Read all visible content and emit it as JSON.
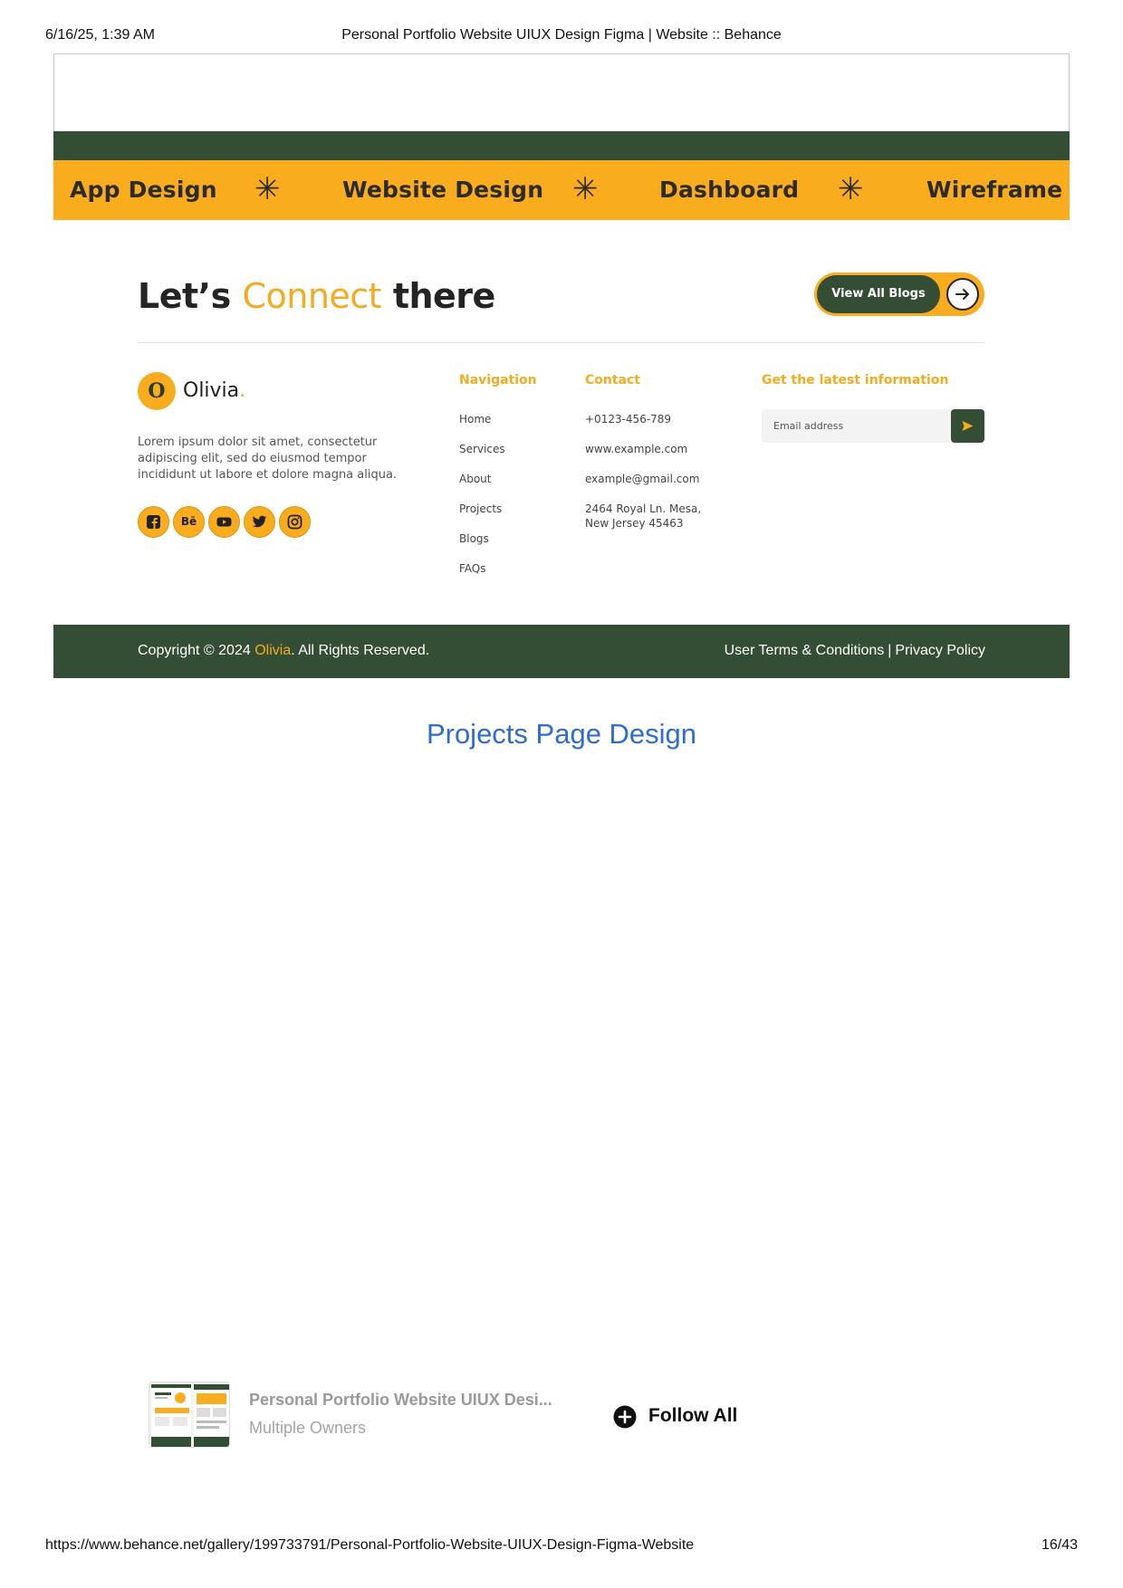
{
  "print_header": {
    "datetime": "6/16/25, 1:39 AM",
    "title": "Personal Portfolio Website UIUX Design Figma | Website :: Behance"
  },
  "print_footer": {
    "url": "https://www.behance.net/gallery/199733791/Personal-Portfolio-Website-UIUX-Design-Figma-Website",
    "page": "16/43"
  },
  "marquee": {
    "items": [
      "App Design",
      "Website Design",
      "Dashboard",
      "Wireframe"
    ],
    "separator": "✳"
  },
  "connect": {
    "heading_start": "Let’s",
    "heading_accent": "Connect",
    "heading_end": "there",
    "button_label": "View All Blogs",
    "button_icon": "arrow-right-icon"
  },
  "brand": {
    "badge_letter": "O",
    "name": "Olivia",
    "name_dot": ".",
    "description": "Lorem ipsum dolor sit amet, consectetur adipiscing elit, sed do eiusmod tempor incididunt ut labore et dolore magna aliqua.",
    "socials": [
      "facebook-icon",
      "behance-icon",
      "youtube-icon",
      "twitter-icon",
      "instagram-icon"
    ],
    "behance_label": "Bē"
  },
  "navigation": {
    "title": "Navigation",
    "links": [
      "Home",
      "Services",
      "About",
      "Projects",
      "Blogs",
      "FAQs"
    ]
  },
  "contact": {
    "title": "Contact",
    "phone": "+0123-456-789",
    "website": "www.example.com",
    "email": "example@gmail.com",
    "address_line1": "2464 Royal Ln. Mesa,",
    "address_line2": "New Jersey 45463"
  },
  "newsletter": {
    "title": "Get the latest information",
    "placeholder": "Email address",
    "send_icon": "send-icon"
  },
  "bottom_bar": {
    "copy_prefix": "Copyright © 2024",
    "copy_brand": "Olivia",
    "copy_suffix": ". All Rights Reserved.",
    "terms": "User Terms & Conditions",
    "separator": "|",
    "privacy": "Privacy Policy"
  },
  "section_heading": "Projects Page Design",
  "owner_card": {
    "title": "Personal Portfolio Website UIUX Desi...",
    "subtitle": "Multiple Owners",
    "follow_label": "Follow All"
  },
  "colors": {
    "brand_green": "#344d35",
    "brand_yellow": "#f8ac1e",
    "accent_text": "#f3ac22",
    "link_blue": "#2f6ad9"
  }
}
